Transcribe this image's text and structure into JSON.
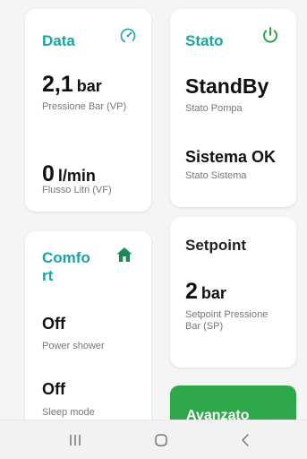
{
  "data_card": {
    "title": "Data",
    "icon": "gauge-icon",
    "pressure_value": "2,1",
    "pressure_unit": "bar",
    "pressure_caption": "Pressione Bar (VP)",
    "flow_value": "0",
    "flow_unit": "l/min",
    "flow_caption": "Flusso Litri (VF)"
  },
  "stato_card": {
    "title": "Stato",
    "icon": "power-icon",
    "pump_value": "StandBy",
    "pump_caption": "Stato Pompa",
    "system_value": "Sistema OK",
    "system_caption": "Stato Sistema"
  },
  "comfort_card": {
    "title_line1": "Comfo",
    "title_line2": "rt",
    "icon": "home-icon",
    "power_value": "Off",
    "power_caption": "Power shower",
    "sleep_value": "Off",
    "sleep_caption": "Sleep mode"
  },
  "setpoint_card": {
    "title": "Setpoint",
    "value": "2",
    "unit": "bar",
    "caption": "Setpoint Pressione Bar (SP)"
  },
  "avanzato_button": {
    "label": "Avanzato"
  },
  "colors": {
    "accent": "#1ba39c",
    "button_green": "#2ea84a"
  },
  "navbar": {
    "recents_icon": "recents-icon",
    "home_icon": "home-nav-icon",
    "back_icon": "back-icon"
  }
}
